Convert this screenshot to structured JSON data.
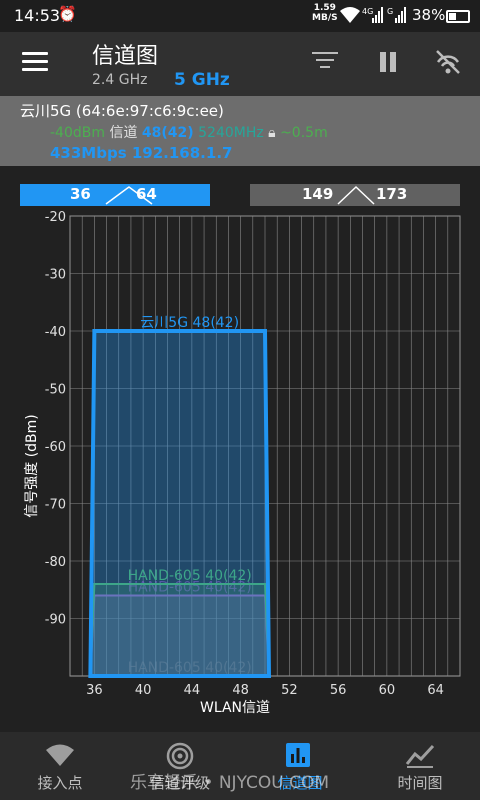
{
  "status_bar": {
    "time": "14:53",
    "net_speed_value": "1.59",
    "net_speed_unit": "MB/S",
    "battery": "38%",
    "icons": [
      "alarm-icon",
      "wifi-icon",
      "4g-signal-icon",
      "g-signal-icon",
      "battery-icon"
    ]
  },
  "app_bar": {
    "title": "信道图",
    "band_24": "2.4 GHz",
    "band_5": "5 GHz",
    "icons": [
      "menu-icon",
      "filter-icon",
      "pause-icon",
      "wifi-off-icon"
    ]
  },
  "connected_ap": {
    "name": "云川5G (64:6e:97:c6:9c:ee)",
    "signal": "-40dBm",
    "channel_label": "信道",
    "channel": "48(42)",
    "frequency": "5240MHz",
    "distance": "~0.5m",
    "link": "433Mbps 192.168.1.7"
  },
  "range_tabs": [
    {
      "start": "36",
      "end": "64",
      "active": true
    },
    {
      "start": "149",
      "end": "173",
      "active": false
    }
  ],
  "chart_data": {
    "type": "area",
    "xlabel": "WLAN信道",
    "ylabel": "信号强度 (dBm)",
    "x_ticks": [
      36,
      40,
      44,
      48,
      52,
      56,
      60,
      64
    ],
    "y_ticks": [
      -20,
      -30,
      -40,
      -50,
      -60,
      -70,
      -80,
      -90
    ],
    "xlim": [
      34,
      66
    ],
    "ylim": [
      -100,
      -20
    ],
    "grid": true,
    "series": [
      {
        "name": "云川5G 48(42)",
        "channel_from": 36,
        "channel_to": 50,
        "signal_dbm": -40,
        "color": "#2196f3"
      },
      {
        "name": "HAND-605 40(42)",
        "channel_from": 36,
        "channel_to": 50,
        "signal_dbm": -84,
        "color": "#4caf50"
      },
      {
        "name": "HAND-605 40(42)",
        "channel_from": 36,
        "channel_to": 50,
        "signal_dbm": -86,
        "color": "#ab47bc"
      },
      {
        "name": "HAND-605 40(42)",
        "channel_from": 36,
        "channel_to": 50,
        "signal_dbm": -100,
        "color": "#8d6e63"
      }
    ]
  },
  "bottom_nav": [
    {
      "label": "接入点",
      "icon": "wifi-icon",
      "active": false
    },
    {
      "label": "信道评级",
      "icon": "radar-icon",
      "active": false
    },
    {
      "label": "信道图",
      "icon": "bar-chart-icon",
      "active": true
    },
    {
      "label": "时间图",
      "icon": "line-chart-icon",
      "active": false
    }
  ],
  "watermark": "乐享轻乐 • NJYCOU.COM"
}
